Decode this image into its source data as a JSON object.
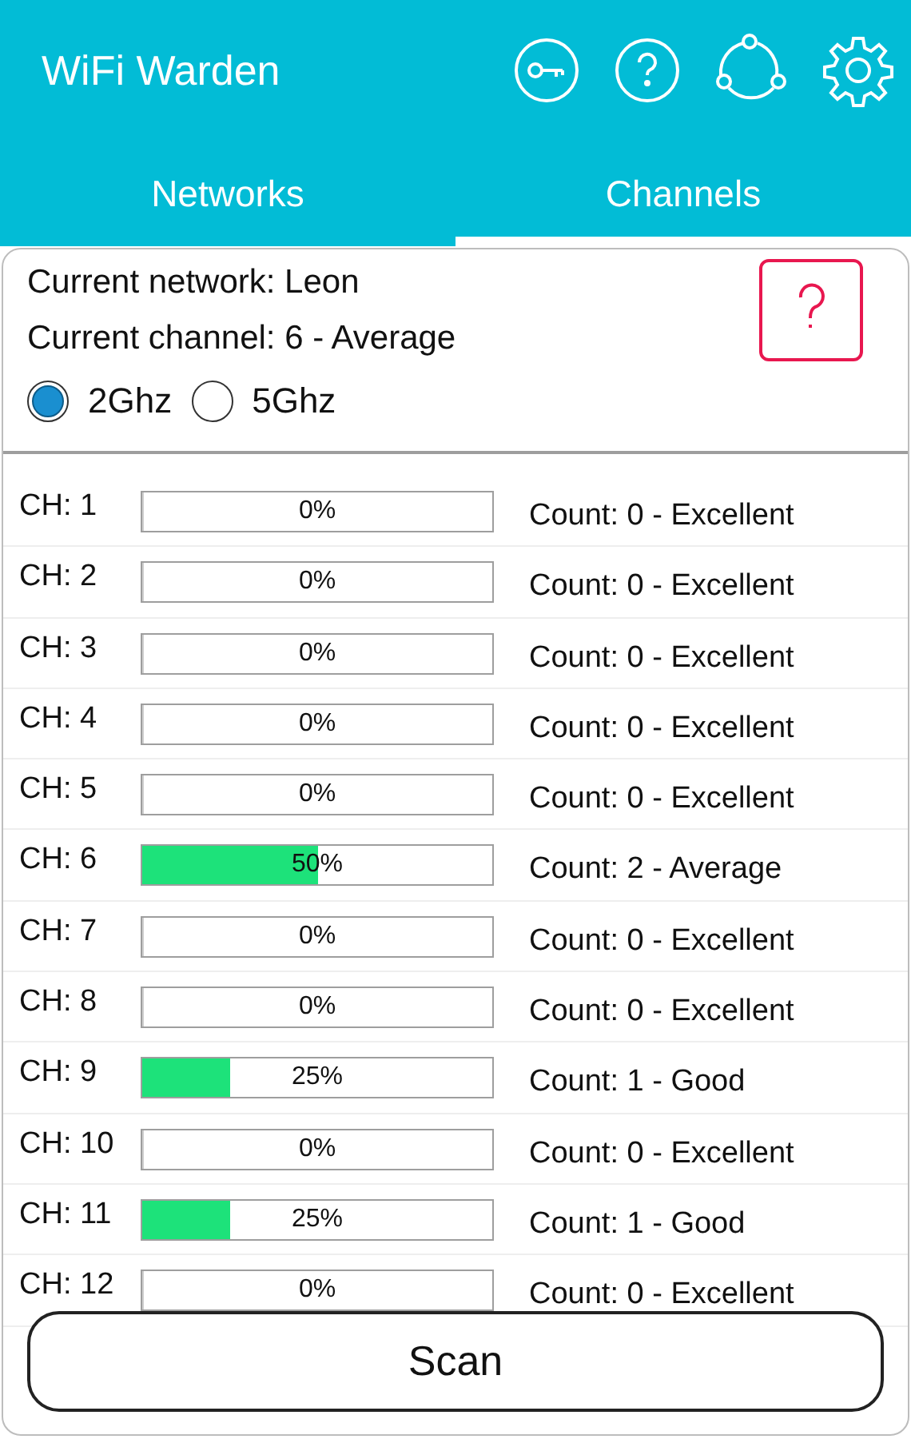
{
  "app_bar": {
    "title": "WiFi Warden"
  },
  "tabs": [
    {
      "label": "Networks",
      "selected": false
    },
    {
      "label": "Channels",
      "selected": true
    }
  ],
  "info": {
    "current_network": "Current network: Leon",
    "current_channel": "Current channel: 6 - Average"
  },
  "bands": [
    {
      "label": "2Ghz",
      "selected": true
    },
    {
      "label": "5Ghz",
      "selected": false
    }
  ],
  "channels": [
    {
      "name": "CH: 1",
      "level": 0,
      "reading": "0%",
      "status": "Count: 0 - Excellent"
    },
    {
      "name": "CH: 2",
      "level": 0,
      "reading": "0%",
      "status": "Count: 0 - Excellent"
    },
    {
      "name": "CH: 3",
      "level": 0,
      "reading": "0%",
      "status": "Count: 0 - Excellent"
    },
    {
      "name": "CH: 4",
      "level": 0,
      "reading": "0%",
      "status": "Count: 0 - Excellent"
    },
    {
      "name": "CH: 5",
      "level": 0,
      "reading": "0%",
      "status": "Count: 0 - Excellent"
    },
    {
      "name": "CH: 6",
      "level": 0.5,
      "reading": "50%",
      "status": "Count: 2 - Average"
    },
    {
      "name": "CH: 7",
      "level": 0,
      "reading": "0%",
      "status": "Count: 0 - Excellent"
    },
    {
      "name": "CH: 8",
      "level": 0,
      "reading": "0%",
      "status": "Count: 0 - Excellent"
    },
    {
      "name": "CH: 9",
      "level": 0.25,
      "reading": "25%",
      "status": "Count: 1 - Good"
    },
    {
      "name": "CH: 10",
      "level": 0,
      "reading": "0%",
      "status": "Count: 0 - Excellent"
    },
    {
      "name": "CH: 11",
      "level": 0.25,
      "reading": "25%",
      "status": "Count: 1 - Good"
    },
    {
      "name": "CH: 12",
      "level": 0,
      "reading": "0%",
      "status": "Count: 0 - Excellent"
    }
  ],
  "scan_button": "Scan"
}
